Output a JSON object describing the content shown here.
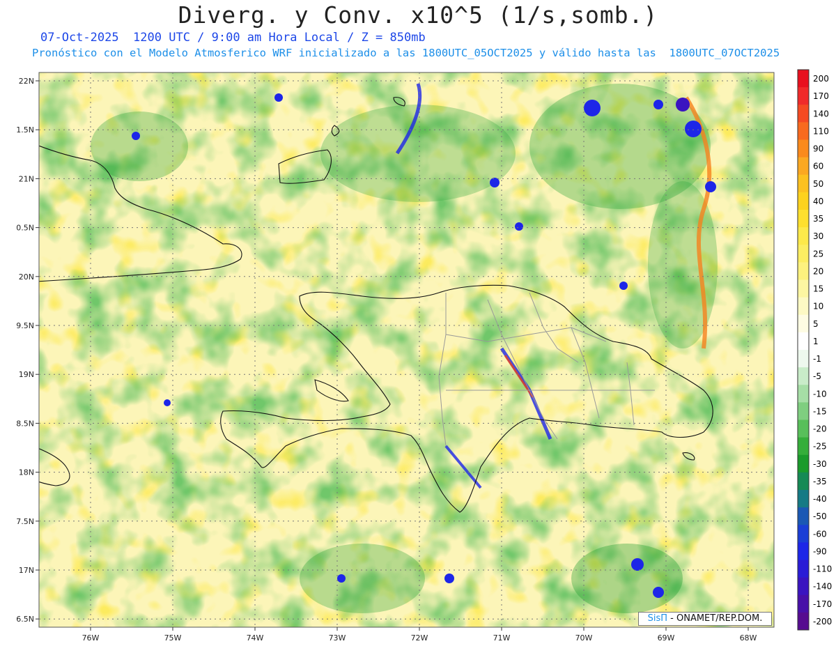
{
  "header": {
    "title": "Diverg. y Conv. x10^5 (1/s,somb.)",
    "subtitle": "07-Oct-2025  1200 UTC / 9:00 am Hora Local / Z = 850mb",
    "subtitle2": "Pronóstico con el Modelo Atmosferico WRF inicializado a las 1800UTC_05OCT2025 y válido hasta las  1800UTC_07OCT2025"
  },
  "map": {
    "lon_range": [
      -76.55,
      -67.6
    ],
    "lat_range": [
      6.45,
      22.1
    ],
    "lon_ticks": [
      "76W",
      "75W",
      "74W",
      "73W",
      "72W",
      "71W",
      "70W",
      "69W",
      "68W"
    ],
    "lat_ticks": [
      "22N",
      "1.5N",
      "21N",
      "0.5N",
      "20N",
      "9.5N",
      "19N",
      "8.5N",
      "18N",
      "7.5N",
      "17N",
      "6.5N"
    ],
    "gridlines": "dotted"
  },
  "colorbar": {
    "levels": [
      "200",
      "170",
      "140",
      "110",
      "90",
      "60",
      "50",
      "40",
      "35",
      "30",
      "25",
      "20",
      "15",
      "10",
      "5",
      "1",
      "-1",
      "-5",
      "-10",
      "-15",
      "-20",
      "-25",
      "-30",
      "-35",
      "-40",
      "-50",
      "-60",
      "-90",
      "-110",
      "-140",
      "-170",
      "-200"
    ],
    "colors": [
      "#e8101e",
      "#f02a2a",
      "#f54a22",
      "#f86a1e",
      "#fa8a1c",
      "#fba822",
      "#fcc120",
      "#fdd21e",
      "#fee02e",
      "#fde94a",
      "#fcee62",
      "#fdf27e",
      "#fdf6a2",
      "#fdf9c4",
      "#fefce3",
      "#ffffff",
      "#eef8ee",
      "#c9ecc9",
      "#a6dea6",
      "#7fce80",
      "#58bf5a",
      "#35ae3a",
      "#1a9b2b",
      "#168a55",
      "#157a85",
      "#1a58b4",
      "#1a3ed6",
      "#1d26e8",
      "#2a1cd6",
      "#3a14c0",
      "#4810a8",
      "#560c90"
    ]
  },
  "credit": {
    "brand": "SisΠ",
    "rest": "- ONAMET/REP.DOM."
  }
}
